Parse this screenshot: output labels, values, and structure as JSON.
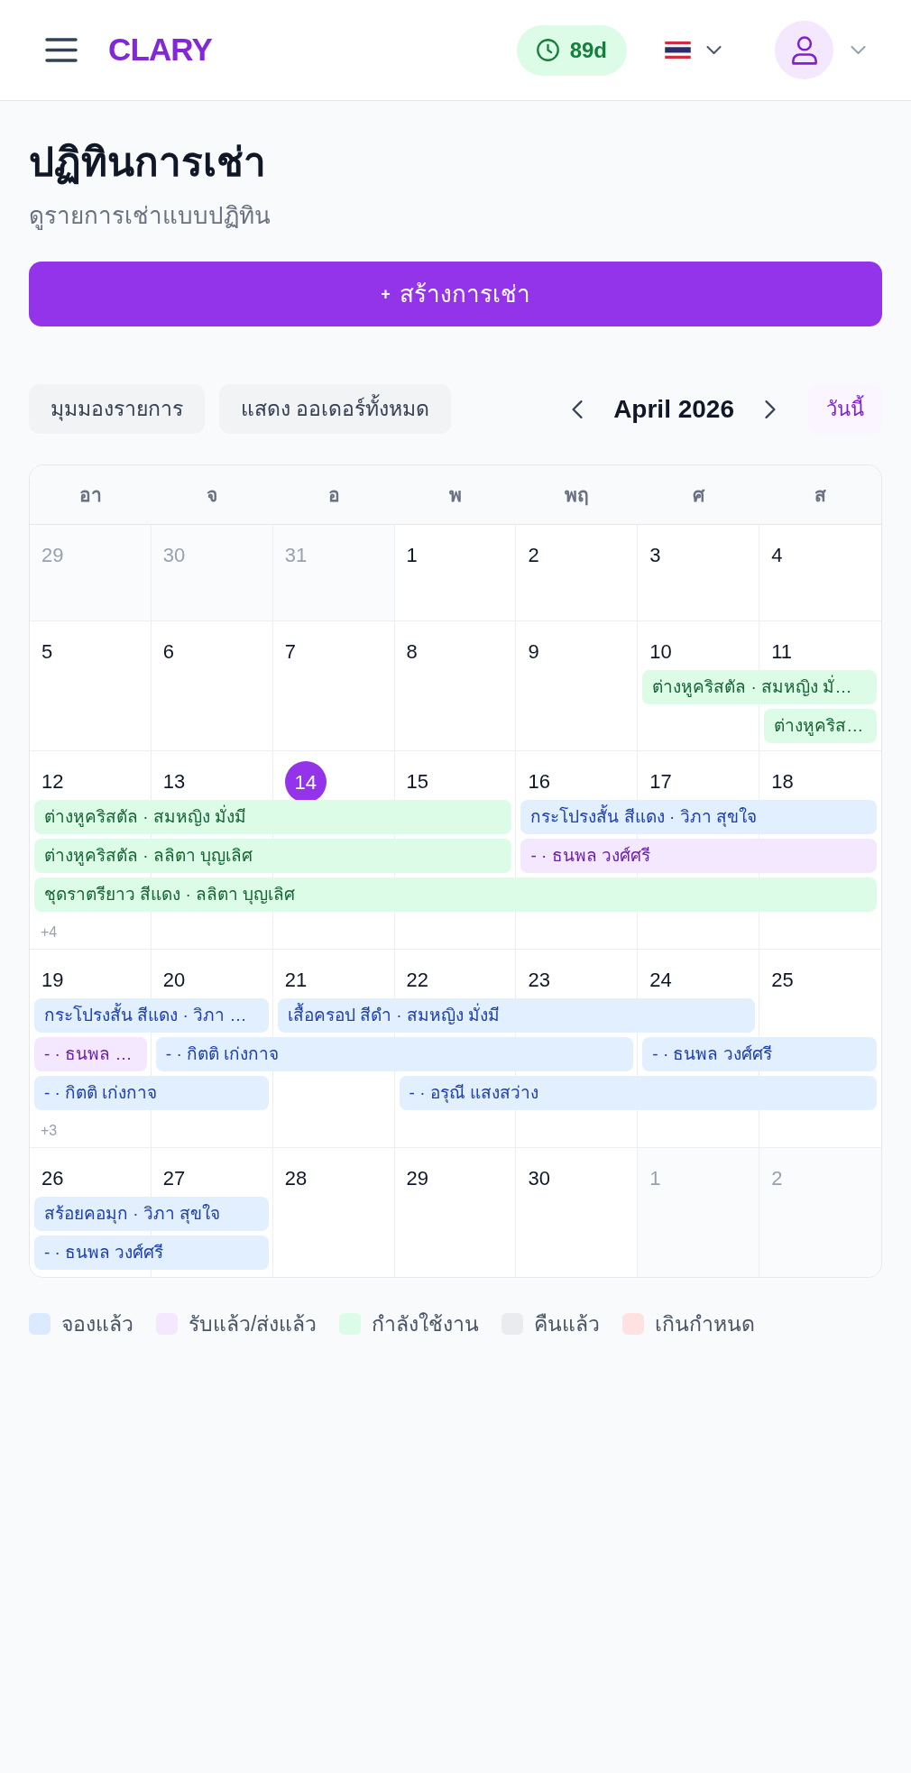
{
  "header": {
    "brand": "CLARY",
    "badge": "89d"
  },
  "page": {
    "title": "ปฏิทินการเช่า",
    "subtitle": "ดูรายการเช่าแบบปฏิทิน",
    "create_button": {
      "prefix": "+",
      "label": "สร้างการเช่า"
    }
  },
  "toolbar": {
    "view_button": "มุมมองรายการ",
    "filter_button": "แสดง ออเดอร์ทั้งหมด",
    "month": "April 2026",
    "today_button": "วันนี้"
  },
  "calendar": {
    "weekdays": [
      "อา",
      "จ",
      "อ",
      "พ",
      "พฤ",
      "ศ",
      "ส"
    ],
    "weeks": [
      {
        "days": [
          {
            "date": "29",
            "muted": true,
            "today": false
          },
          {
            "date": "30",
            "muted": true,
            "today": false
          },
          {
            "date": "31",
            "muted": true,
            "today": false
          },
          {
            "date": "1",
            "muted": false,
            "today": false
          },
          {
            "date": "2",
            "muted": false,
            "today": false
          },
          {
            "date": "3",
            "muted": false,
            "today": false
          },
          {
            "date": "4",
            "muted": false,
            "today": false
          }
        ]
      },
      {
        "days": [
          {
            "date": "5",
            "muted": false,
            "today": false
          },
          {
            "date": "6",
            "muted": false,
            "today": false
          },
          {
            "date": "7",
            "muted": false,
            "today": false
          },
          {
            "date": "8",
            "muted": false,
            "today": false
          },
          {
            "date": "9",
            "muted": false,
            "today": false
          },
          {
            "date": "10",
            "muted": false,
            "today": false
          },
          {
            "date": "11",
            "muted": false,
            "today": false
          }
        ],
        "lanes": [
          [
            {
              "kind": "empty"
            },
            {
              "kind": "empty"
            },
            {
              "kind": "empty"
            },
            {
              "kind": "empty"
            },
            {
              "kind": "empty"
            },
            {
              "kind": "active",
              "label": "ต่างหูคริสตัล · สมหญิง มั่…"
            },
            {
              "kind": "continued"
            }
          ],
          [
            {
              "kind": "empty"
            },
            {
              "kind": "empty"
            },
            {
              "kind": "empty"
            },
            {
              "kind": "empty"
            },
            {
              "kind": "empty"
            },
            {
              "kind": "empty"
            },
            {
              "kind": "active",
              "label": "ต่างหูคริส…"
            }
          ]
        ]
      },
      {
        "days": [
          {
            "date": "12",
            "muted": false,
            "today": false
          },
          {
            "date": "13",
            "muted": false,
            "today": false
          },
          {
            "date": "14",
            "muted": false,
            "today": true
          },
          {
            "date": "15",
            "muted": false,
            "today": false
          },
          {
            "date": "16",
            "muted": false,
            "today": false
          },
          {
            "date": "17",
            "muted": false,
            "today": false
          },
          {
            "date": "18",
            "muted": false,
            "today": false
          }
        ],
        "lanes": [
          [
            {
              "kind": "active",
              "label": "ต่างหูคริสตัล · สมหญิง มั่งมี"
            },
            {
              "kind": "continued"
            },
            {
              "kind": "continued"
            },
            {
              "kind": "continued"
            },
            {
              "kind": "booked",
              "label": "กระโปรงสั้น สีแดง · วิภา สุขใจ"
            },
            {
              "kind": "continued"
            },
            {
              "kind": "continued"
            }
          ],
          [
            {
              "kind": "active",
              "label": "ต่างหูคริสตัล · ลลิตา บุญเลิศ"
            },
            {
              "kind": "continued"
            },
            {
              "kind": "continued"
            },
            {
              "kind": "continued"
            },
            {
              "kind": "picked",
              "label": "- · ธนพล วงศ์ศรี"
            },
            {
              "kind": "continued"
            },
            {
              "kind": "continued"
            }
          ],
          [
            {
              "kind": "active",
              "label": "ชุดราตรียาว สีแดง · ลลิตา บุญเลิศ"
            },
            {
              "kind": "continued"
            },
            {
              "kind": "continued"
            },
            {
              "kind": "continued"
            },
            {
              "kind": "continued"
            },
            {
              "kind": "continued"
            },
            {
              "kind": "continued"
            }
          ]
        ],
        "more": "+4"
      },
      {
        "days": [
          {
            "date": "19",
            "muted": false,
            "today": false
          },
          {
            "date": "20",
            "muted": false,
            "today": false
          },
          {
            "date": "21",
            "muted": false,
            "today": false
          },
          {
            "date": "22",
            "muted": false,
            "today": false
          },
          {
            "date": "23",
            "muted": false,
            "today": false
          },
          {
            "date": "24",
            "muted": false,
            "today": false
          },
          {
            "date": "25",
            "muted": false,
            "today": false
          }
        ],
        "lanes": [
          [
            {
              "kind": "booked",
              "label": "กระโปรงสั้น สีแดง · วิภา …"
            },
            {
              "kind": "continued"
            },
            {
              "kind": "booked",
              "label": "เสื้อครอป สีดำ · สมหญิง มั่งมี"
            },
            {
              "kind": "continued"
            },
            {
              "kind": "continued"
            },
            {
              "kind": "continued"
            },
            {
              "kind": "empty"
            }
          ],
          [
            {
              "kind": "picked",
              "label": "- · ธนพล …"
            },
            {
              "kind": "booked",
              "label": "- · กิตติ เก่งกาจ"
            },
            {
              "kind": "continued"
            },
            {
              "kind": "continued"
            },
            {
              "kind": "continued"
            },
            {
              "kind": "booked",
              "label": "- · ธนพล วงศ์ศรี"
            },
            {
              "kind": "continued"
            }
          ],
          [
            {
              "kind": "booked",
              "label": "- · กิตติ เก่งกาจ"
            },
            {
              "kind": "continued"
            },
            {
              "kind": "empty"
            },
            {
              "kind": "booked",
              "label": "- · อรุณี แสงสว่าง"
            },
            {
              "kind": "continued"
            },
            {
              "kind": "continued"
            },
            {
              "kind": "continued"
            }
          ]
        ],
        "more": "+3"
      },
      {
        "days": [
          {
            "date": "26",
            "muted": false,
            "today": false
          },
          {
            "date": "27",
            "muted": false,
            "today": false
          },
          {
            "date": "28",
            "muted": false,
            "today": false
          },
          {
            "date": "29",
            "muted": false,
            "today": false
          },
          {
            "date": "30",
            "muted": false,
            "today": false
          },
          {
            "date": "1",
            "muted": true,
            "today": false
          },
          {
            "date": "2",
            "muted": true,
            "today": false
          }
        ],
        "lanes": [
          [
            {
              "kind": "booked",
              "label": "สร้อยคอมุก · วิภา สุขใจ"
            },
            {
              "kind": "continued"
            },
            {
              "kind": "empty"
            },
            {
              "kind": "empty"
            },
            {
              "kind": "empty"
            },
            {
              "kind": "empty"
            },
            {
              "kind": "empty"
            }
          ],
          [
            {
              "kind": "booked",
              "label": "- · ธนพล วงศ์ศรี"
            },
            {
              "kind": "continued"
            },
            {
              "kind": "empty"
            },
            {
              "kind": "empty"
            },
            {
              "kind": "empty"
            },
            {
              "kind": "empty"
            },
            {
              "kind": "empty"
            }
          ]
        ]
      }
    ]
  },
  "legend": [
    {
      "label": "จองแล้ว",
      "color": "#dbeafe"
    },
    {
      "label": "รับแล้ว/ส่งแล้ว",
      "color": "#f3e8ff"
    },
    {
      "label": "กำลังใช้งาน",
      "color": "#dcfce7"
    },
    {
      "label": "คืนแล้ว",
      "color": "#e9ebee"
    },
    {
      "label": "เกินกำหนด",
      "color": "#fee2e2"
    }
  ]
}
